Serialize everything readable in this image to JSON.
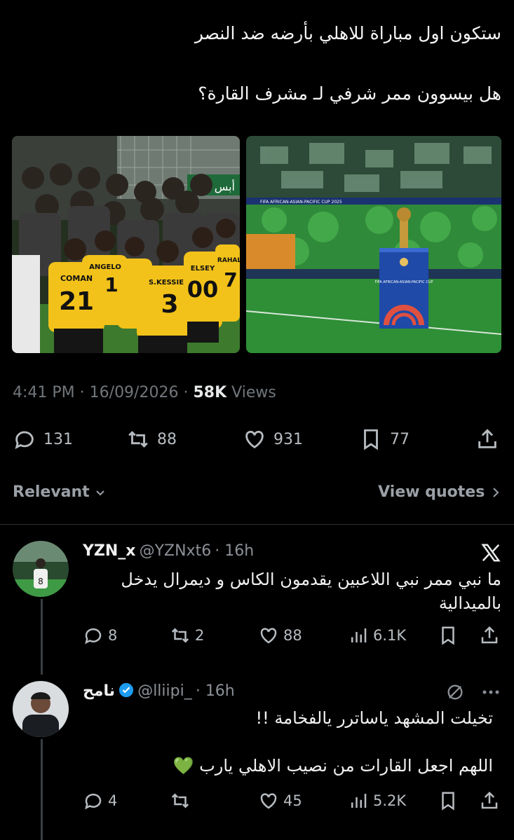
{
  "tweet": {
    "line1": "ستكون اول مباراة للاهلي بأرضه ضد النصر",
    "line2": "هل بيسوون ممر شرفي لـ مشرف القارة؟",
    "image_left": {
      "jerseys": [
        {
          "name": "COMAN",
          "number": "21"
        },
        {
          "name": "ANGELO",
          "number": "1"
        },
        {
          "name": "S.KESSIE",
          "number": "3"
        },
        {
          "name": "ELSEY",
          "number": "00"
        },
        {
          "name": "RAHAL",
          "number": "7"
        }
      ],
      "banner_text": "أبس البيو"
    },
    "image_right": {
      "trophy_stand_text": "FIFA AFRICAN-ASIAN-PACIFIC CUP",
      "board_text": "FIFA AFRICAN-ASIAN-PACIFIC CUP 2025"
    },
    "time": "4:41 PM",
    "date": "16/09/2026",
    "views_count": "58K",
    "views_label": "Views",
    "replies": "131",
    "reposts": "88",
    "likes": "931",
    "bookmarks": "77"
  },
  "sort": {
    "relevant_label": "Relevant",
    "quotes_label": "View quotes"
  },
  "replies": [
    {
      "name": "YZN_x",
      "handle": "@YZNxt6",
      "time": "16h",
      "text_line1": "ما نبي ممر نبي اللاعبين يقدمون الكاس و ديمرال يدخل",
      "text_line2": "بالميدالية",
      "replies": "8",
      "reposts": "2",
      "likes": "88",
      "views": "6.1K",
      "avatar_shirt_number": "8"
    },
    {
      "name": "نامح",
      "handle": "@lliipi_",
      "time": "16h",
      "text_line1": "تخيلت المشهد ياساترر يالفخامة !!",
      "text_line2": "اللهم اجعل القارات من نصيب الاهلي يارب 💚",
      "replies": "4",
      "reposts": "",
      "likes": "45",
      "views": "5.2K"
    }
  ],
  "colors": {
    "background": "#000000",
    "text": "#e7e9ea",
    "muted": "#71767b",
    "verified": "#1d9bf0",
    "pitch_green": "#2f8a3a",
    "kit_yellow": "#f2c21a"
  }
}
